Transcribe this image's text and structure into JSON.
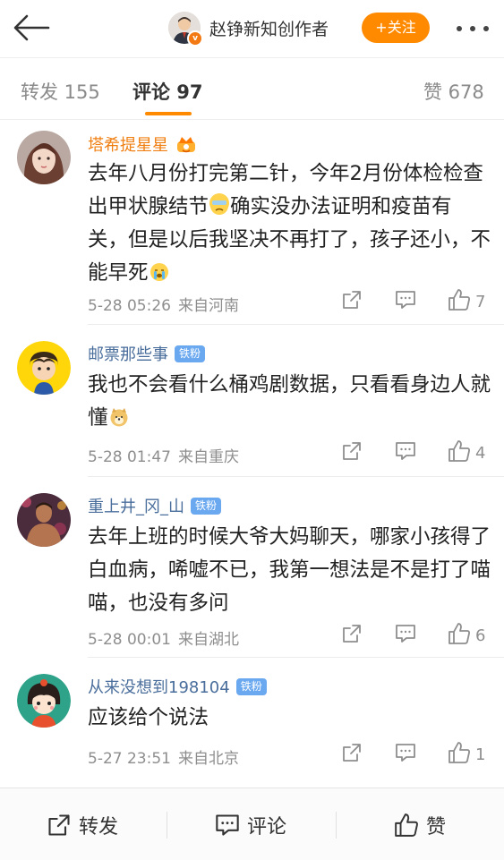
{
  "header": {
    "author_name": "赵铮新知创作者",
    "follow_label": "+关注"
  },
  "tabs": [
    {
      "label": "转发 155"
    },
    {
      "label": "评论 97"
    },
    {
      "label": "赞 678"
    }
  ],
  "comments": [
    {
      "name": "塔希提星星",
      "text_1": "去年八月份打完第二针，今年2月份体检检查出甲状腺结节",
      "text_2": "确实没办法证明和疫苗有关，但是以后我坚决不再打了，孩子还小，不能早死",
      "time": "5-28 05:26",
      "location": "来自河南",
      "likes": "7"
    },
    {
      "name": "邮票那些事",
      "badge": "铁粉",
      "text_1": "我也不会看什么桶鸡剧数据，只看看身边人就懂",
      "time": "5-28 01:47",
      "location": "来自重庆",
      "likes": "4"
    },
    {
      "name": "重上井_冈_山",
      "badge": "铁粉",
      "text_1": "去年上班的时候大爷大妈聊天，哪家小孩得了白血病，唏嘘不已，我第一想法是不是打了喵喵，也没有多问",
      "time": "5-28 00:01",
      "location": "来自湖北",
      "likes": "6"
    },
    {
      "name": "从来没想到198104",
      "badge": "铁粉",
      "text_1": "应该给个说法",
      "time": "5-27 23:51",
      "location": "来自北京",
      "likes": "1"
    }
  ],
  "bottom_bar": {
    "repost_label": "转发",
    "comment_label": "评论",
    "like_label": "赞"
  },
  "colors": {
    "accent": "#ff8a00",
    "username": "#4a6e9c",
    "vip_username": "#f07f12",
    "badge": "#6aa8f0"
  }
}
